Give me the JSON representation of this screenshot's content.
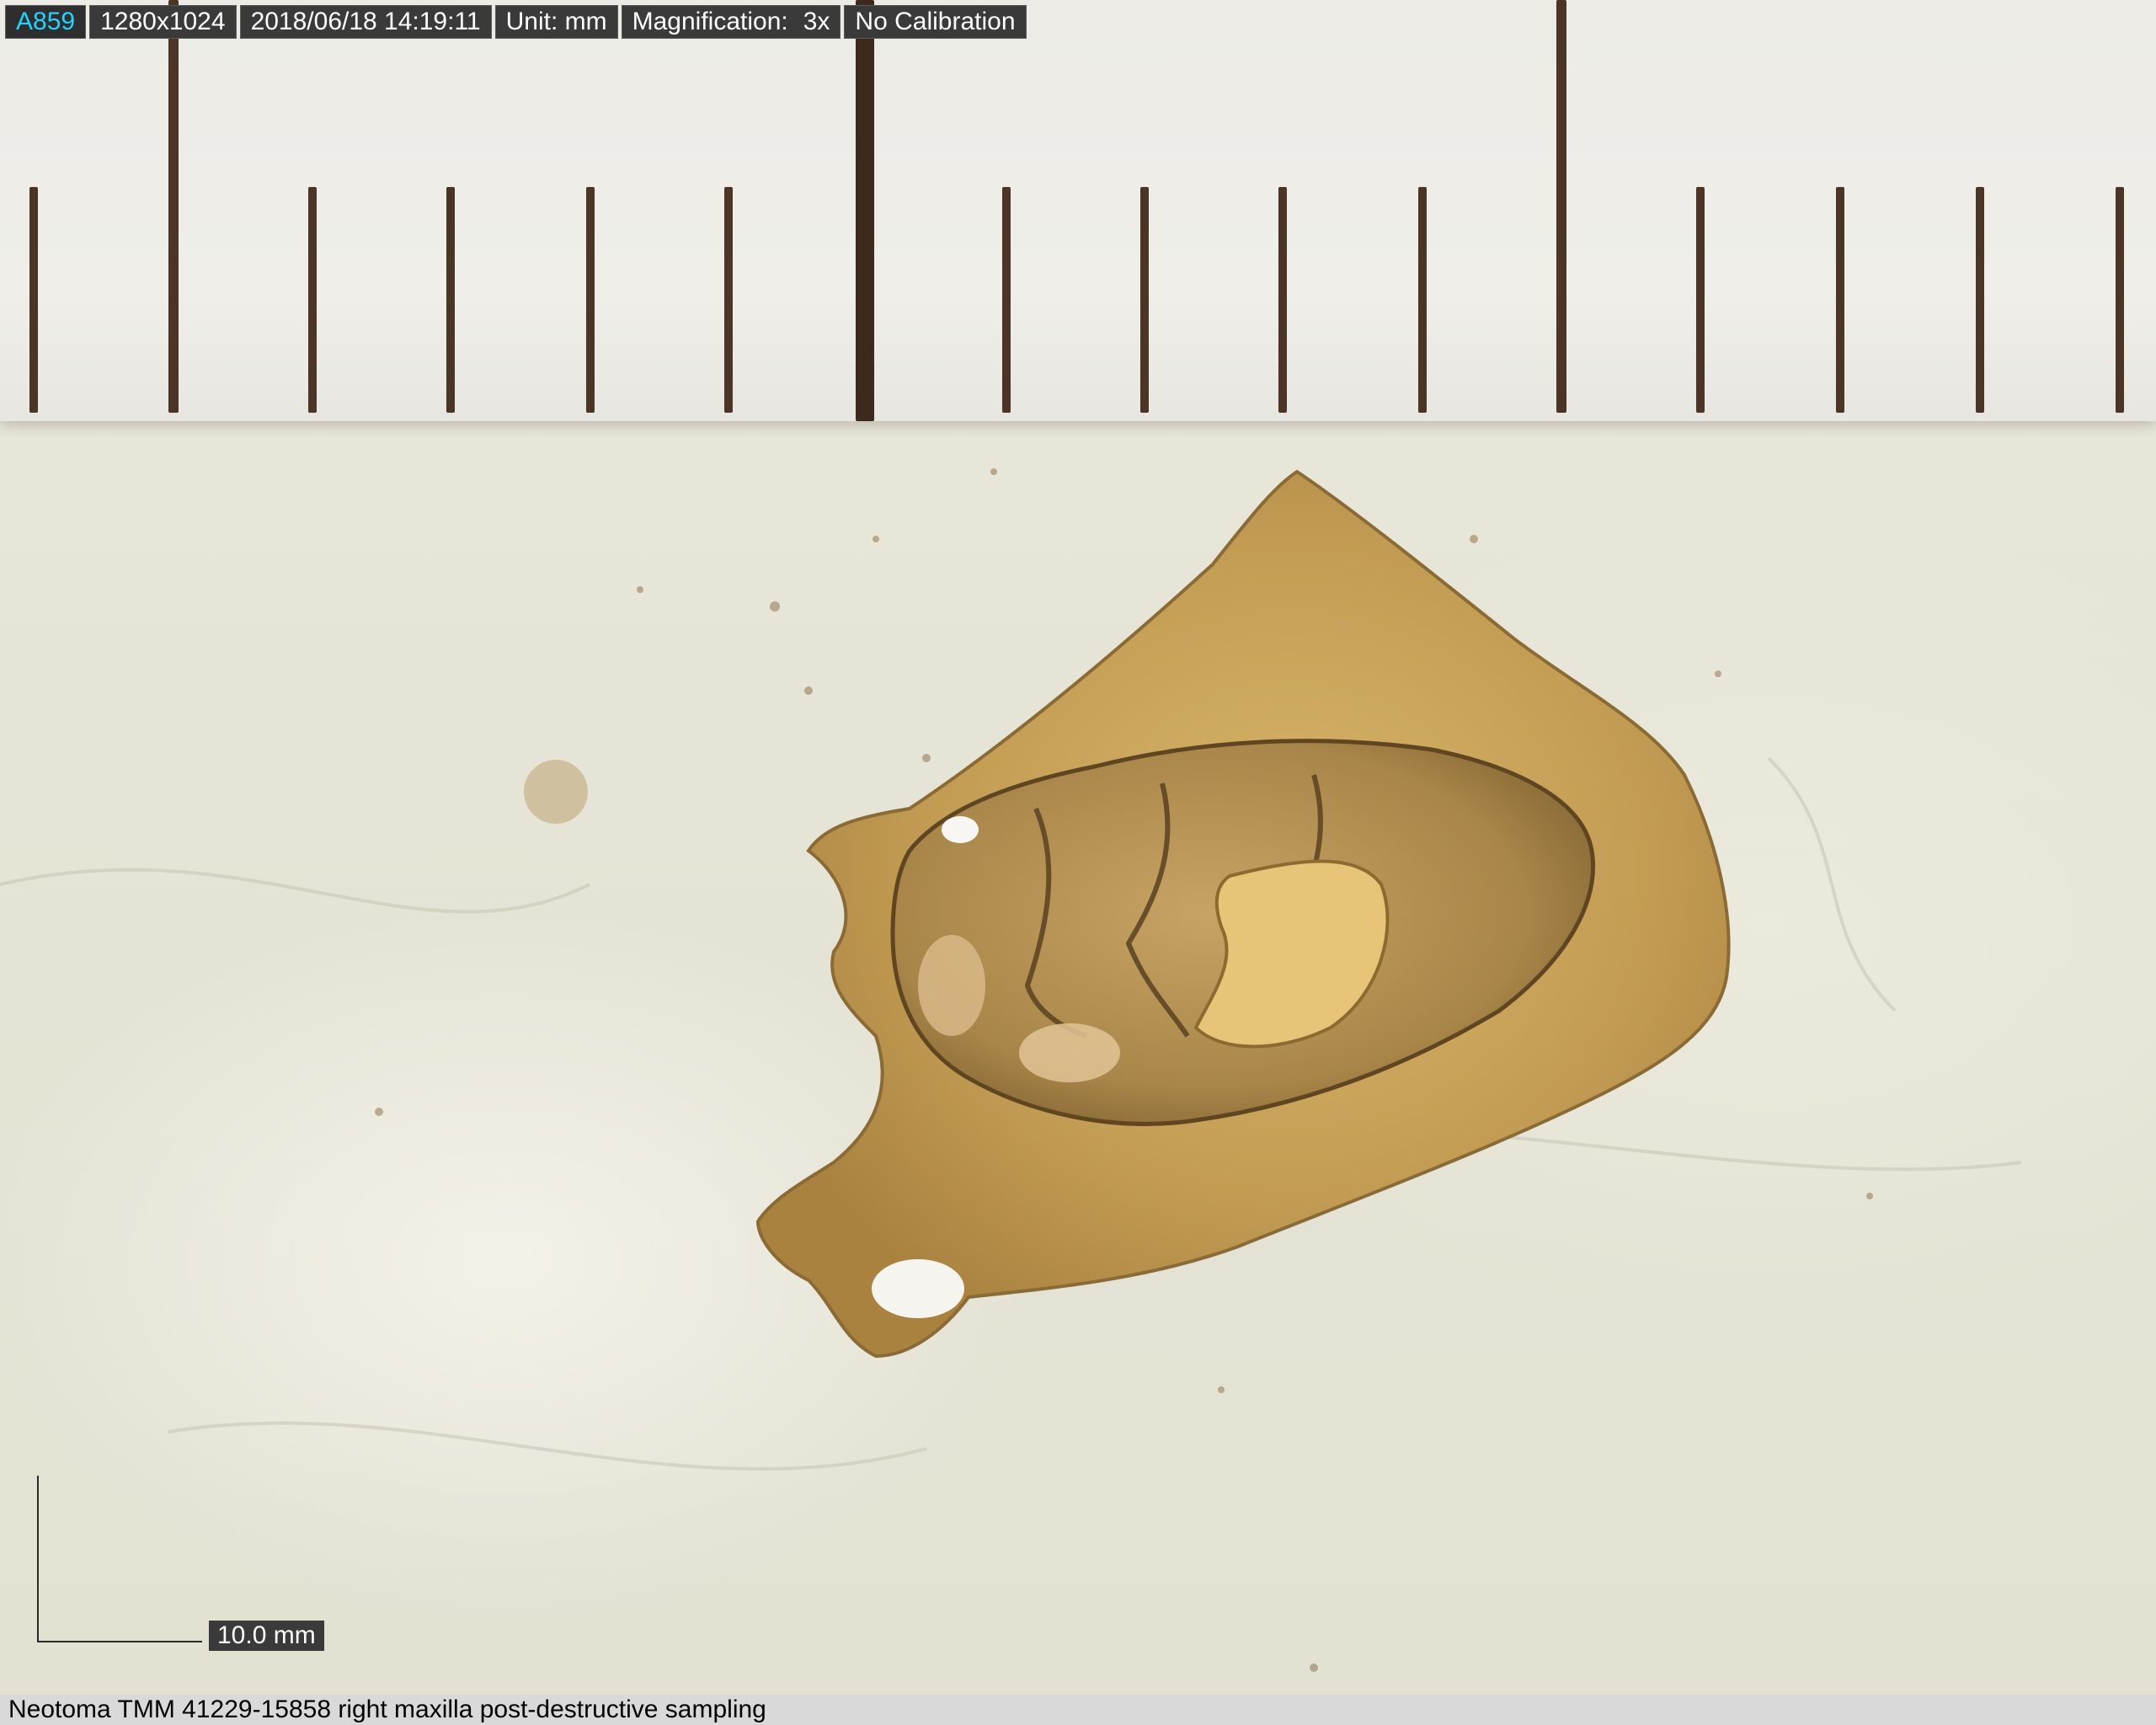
{
  "toolbar": {
    "id": "A859",
    "resolution": "1280x1024",
    "timestamp": "2018/06/18 14:19:11",
    "unit": "Unit: mm",
    "magnification_label": "Magnification:",
    "magnification_value": "3x",
    "calibration": "No Calibration"
  },
  "scale_bar": {
    "label": "10.0 mm"
  },
  "caption": {
    "text": "Neotoma TMM 41229-15858 right maxilla post-destructive sampling"
  },
  "colors": {
    "id_text": "#27d1ff",
    "info_bg": "#3a3a3a",
    "ruler_tick": "#4a3526",
    "background": "#e6e4d6",
    "bone": "#c9a35a",
    "tooth": "#b89457"
  }
}
